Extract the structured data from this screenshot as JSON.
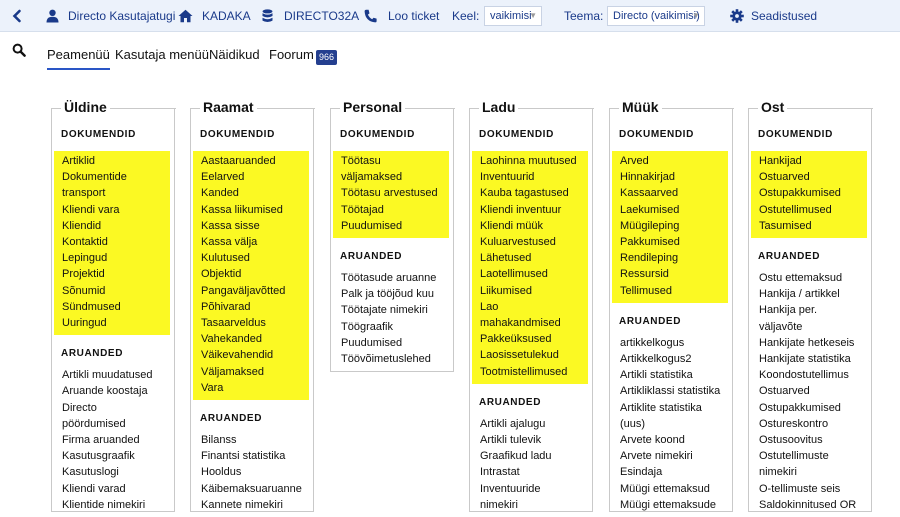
{
  "topbar": {
    "user_label": "Directo Kasutajatugi",
    "home_label": "KADAKA",
    "db_label": "DIRECTO32A",
    "ticket_label": "Loo ticket",
    "lang_label": "Keel:",
    "lang_value": "vaikimisi",
    "theme_label": "Teema:",
    "theme_value": "Directo (vaikimisi)",
    "settings_label": "Seadistused",
    "accent": "#1a3a8a"
  },
  "nav": {
    "tabs": [
      "Peamenüü",
      "Kasutaja menüü",
      "Näidikud",
      "Foorum"
    ],
    "forum_badge": "966"
  },
  "highlight_color": "#fbf923",
  "columns": [
    {
      "title": "Üldine",
      "doc_header": "DOKUMENDID",
      "documents": [
        "Artiklid",
        "Dokumentide",
        "transport",
        "Kliendi vara",
        "Kliendid",
        "Kontaktid",
        "Lepingud",
        "Projektid",
        "Sõnumid",
        "Sündmused",
        "Uuringud"
      ],
      "rep_header": "ARUANDED",
      "reports": [
        "Artikli muudatused",
        "Aruande koostaja",
        "Directo",
        "pöördumised",
        "Firma aruanded",
        "Kasutusgraafik",
        "Kasutuslogi",
        "Kliendi varad",
        "Klientide nimekiri"
      ]
    },
    {
      "title": "Raamat",
      "doc_header": "DOKUMENDID",
      "documents": [
        "Aastaaruanded",
        "Eelarved",
        "Kanded",
        "Kassa liikumised",
        "Kassa sisse",
        "Kassa välja",
        "Kulutused",
        "Objektid",
        "Pangaväljavõtted",
        "Põhivarad",
        "Tasaarveldus",
        "Vahekanded",
        "Väikevahendid",
        "Väljamaksed",
        "Vara"
      ],
      "rep_header": "ARUANDED",
      "reports": [
        "Bilanss",
        "Finantsi statistika",
        "Hooldus",
        "Käibemaksuaruanne",
        "Kannete nimekiri"
      ]
    },
    {
      "title": "Personal",
      "doc_header": "DOKUMENDID",
      "documents": [
        "Töötasu",
        "väljamaksed",
        "Töötasu arvestused",
        "Töötajad",
        "Puudumised"
      ],
      "rep_header": "ARUANDED",
      "reports": [
        "Töötasude aruanne",
        "Palk ja tööjõud kuu",
        "Töötajate nimekiri",
        "Töögraafik",
        "Puudumised",
        "Töövõimetuslehed"
      ]
    },
    {
      "title": "Ladu",
      "doc_header": "DOKUMENDID",
      "documents": [
        "Laohinna muutused",
        "Inventuurid",
        "Kauba tagastused",
        "Kliendi inventuur",
        "Kliendi müük",
        "Kuluarvestused",
        "Lähetused",
        "Laotellimused",
        "Liikumised",
        "Lao",
        "mahakandmised",
        "Pakkeüksused",
        "Laosissetulekud",
        "Tootmistellimused"
      ],
      "rep_header": "ARUANDED",
      "reports": [
        "Artikli ajalugu",
        "Artikli tulevik",
        "Graafikud ladu",
        "Intrastat",
        "Inventuuride",
        "nimekiri"
      ]
    },
    {
      "title": "Müük",
      "doc_header": "DOKUMENDID",
      "documents": [
        "Arved",
        "Hinnakirjad",
        "Kassaarved",
        "Laekumised",
        "Müügileping",
        "Pakkumised",
        "Rendileping",
        "Ressursid",
        "Tellimused"
      ],
      "rep_header": "ARUANDED",
      "reports": [
        "artikkelkogus",
        "Artikkelkogus2",
        "Artikli statistika",
        "Artikliklassi statistika",
        "Artiklite statistika",
        "(uus)",
        "Arvete koond",
        "Arvete nimekiri",
        "Esindaja",
        "Müügi ettemaksud",
        "Müügi ettemaksude"
      ]
    },
    {
      "title": "Ost",
      "doc_header": "DOKUMENDID",
      "documents": [
        "Hankijad",
        "Ostuarved",
        "Ostupakkumised",
        "Ostutellimused",
        "Tasumised"
      ],
      "rep_header": "ARUANDED",
      "reports": [
        "Ostu ettemaksud",
        "Hankija / artikkel",
        "Hankija per.",
        "väljavõte",
        "Hankijate hetkeseis",
        "Hankijate statistika",
        "Koondostutellimus",
        "Ostuarved",
        "Ostupakkumised",
        "Ostureskontro",
        "Ostusoovitus",
        "Ostutellimuste",
        "nimekiri",
        "O-tellimuste seis",
        "Saldokinnitused OR"
      ]
    }
  ]
}
